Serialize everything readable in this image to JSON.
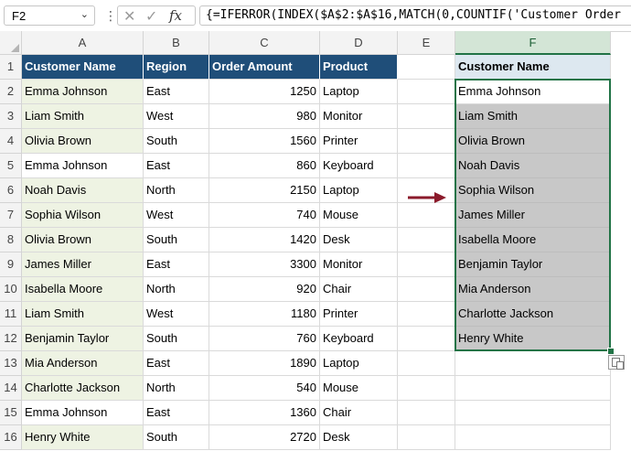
{
  "formula_bar": {
    "name_box": "F2",
    "name_box_dropdown_icon": "chevron-down-icon",
    "more_icon": "vertical-dots-icon",
    "cancel_glyph": "✕",
    "confirm_glyph": "✓",
    "fx_glyph": "fx",
    "formula": "{=IFERROR(INDEX($A$2:$A$16,MATCH(0,COUNTIF('Customer Order"
  },
  "columns": [
    "A",
    "B",
    "C",
    "D",
    "E",
    "F"
  ],
  "rows": [
    "1",
    "2",
    "3",
    "4",
    "5",
    "6",
    "7",
    "8",
    "9",
    "10",
    "11",
    "12",
    "13",
    "14",
    "15",
    "16"
  ],
  "table": {
    "headers": [
      "Customer Name",
      "Region",
      "Order Amount",
      "Product"
    ],
    "rows": [
      [
        "Emma Johnson",
        "East",
        "1250",
        "Laptop"
      ],
      [
        "Liam Smith",
        "West",
        "980",
        "Monitor"
      ],
      [
        "Olivia Brown",
        "South",
        "1560",
        "Printer"
      ],
      [
        "Emma Johnson",
        "East",
        "860",
        "Keyboard"
      ],
      [
        "Noah Davis",
        "North",
        "2150",
        "Laptop"
      ],
      [
        "Sophia Wilson",
        "West",
        "740",
        "Mouse"
      ],
      [
        "Olivia Brown",
        "South",
        "1420",
        "Desk"
      ],
      [
        "James Miller",
        "East",
        "3300",
        "Monitor"
      ],
      [
        "Isabella Moore",
        "North",
        "920",
        "Chair"
      ],
      [
        "Liam Smith",
        "West",
        "1180",
        "Printer"
      ],
      [
        "Benjamin Taylor",
        "South",
        "760",
        "Keyboard"
      ],
      [
        "Mia Anderson",
        "East",
        "1890",
        "Laptop"
      ],
      [
        "Charlotte Jackson",
        "North",
        "540",
        "Mouse"
      ],
      [
        "Emma Johnson",
        "East",
        "1360",
        "Chair"
      ],
      [
        "Henry White",
        "South",
        "2720",
        "Desk"
      ]
    ]
  },
  "result": {
    "header": "Customer Name",
    "values": [
      "Emma Johnson",
      "Liam Smith",
      "Olivia Brown",
      "Noah Davis",
      "Sophia Wilson",
      "James Miller",
      "Isabella Moore",
      "Benjamin Taylor",
      "Mia Anderson",
      "Charlotte Jackson",
      "Henry White"
    ]
  },
  "colors": {
    "header_fill": "#1f4e79",
    "highlight_fill": "#eef3e3",
    "result_fill": "#c8c8c8",
    "selection": "#217346",
    "arrow": "#8b1a2b"
  },
  "icons": {
    "arrow": "right-arrow-icon",
    "paste_options": "paste-options-icon"
  }
}
